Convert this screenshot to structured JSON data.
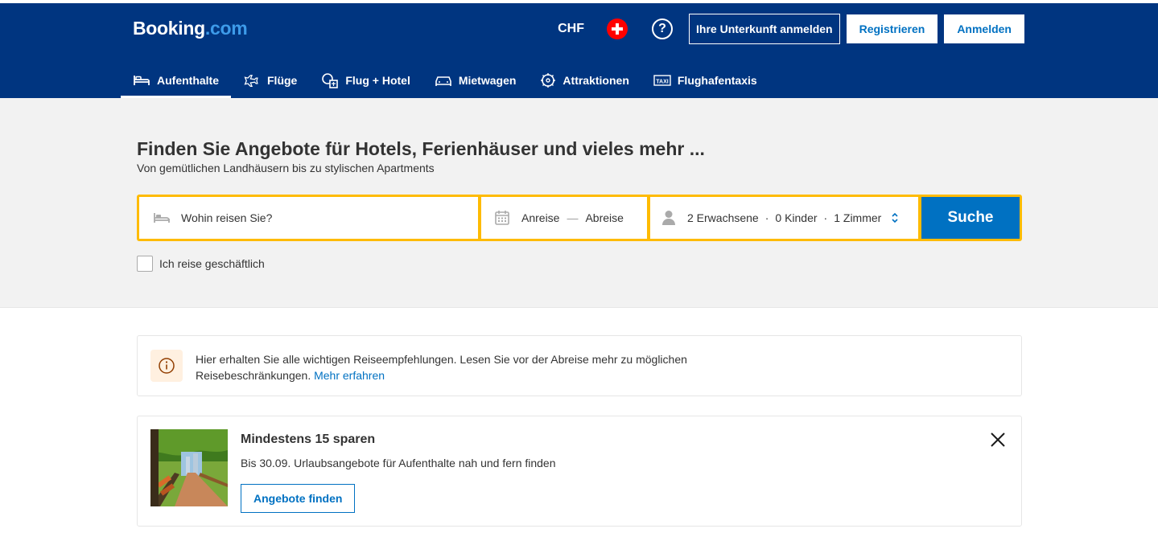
{
  "header": {
    "logo_main": "Booking",
    "logo_dot": ".com",
    "currency": "CHF",
    "flag_icon": "swiss-flag-icon",
    "help_label": "?",
    "list_property": "Ihre Unterkunft anmelden",
    "register": "Registrieren",
    "signin": "Anmelden"
  },
  "nav": {
    "items": [
      {
        "label": "Aufenthalte",
        "icon": "bed-icon",
        "active": true
      },
      {
        "label": "Flüge",
        "icon": "plane-icon"
      },
      {
        "label": "Flug + Hotel",
        "icon": "flight-hotel-icon"
      },
      {
        "label": "Mietwagen",
        "icon": "car-icon"
      },
      {
        "label": "Attraktionen",
        "icon": "attractions-icon"
      },
      {
        "label": "Flughafentaxis",
        "icon": "taxi-icon"
      }
    ]
  },
  "hero": {
    "title": "Finden Sie Angebote für Hotels, Ferienhäuser und vieles mehr ...",
    "subtitle": "Von gemütlichen Landhäusern bis zu stylischen Apartments"
  },
  "search": {
    "destination_placeholder": "Wohin reisen Sie?",
    "checkin": "Anreise",
    "dash": "—",
    "checkout": "Abreise",
    "adults": "2 Erwachsene",
    "children": "0 Kinder",
    "rooms": "1 Zimmer",
    "sep": "·",
    "button": "Suche",
    "business_label": "Ich reise geschäftlich"
  },
  "info": {
    "text": "Hier erhalten Sie alle wichtigen Reiseempfehlungen. Lesen Sie vor der Abreise mehr zu möglichen Reisebeschränkungen.",
    "link": "Mehr erfahren"
  },
  "promo": {
    "title": "Mindestens 15 sparen",
    "subtitle": "Bis 30.09. Urlaubsangebote für Aufenthalte nah und fern finden",
    "button": "Angebote finden"
  },
  "colors": {
    "brand": "#003580",
    "accent": "#0071c2",
    "search_border": "#febb02"
  }
}
